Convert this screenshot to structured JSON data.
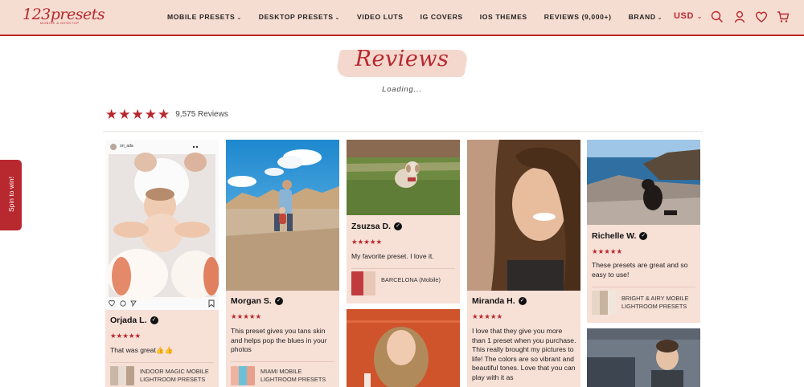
{
  "header": {
    "logo": {
      "text": "123presets",
      "tagline": "MOBILE & DESKTOP"
    },
    "nav": [
      {
        "label": "MOBILE PRESETS",
        "has_dropdown": true
      },
      {
        "label": "DESKTOP PRESETS",
        "has_dropdown": true
      },
      {
        "label": "VIDEO LUTS",
        "has_dropdown": false
      },
      {
        "label": "IG COVERS",
        "has_dropdown": false
      },
      {
        "label": "IOS THEMES",
        "has_dropdown": false
      },
      {
        "label": "REVIEWS (9,000+)",
        "has_dropdown": false
      },
      {
        "label": "BRAND",
        "has_dropdown": true
      }
    ],
    "currency": "USD",
    "icons": [
      "search-icon",
      "account-icon",
      "heart-icon",
      "cart-icon"
    ]
  },
  "page": {
    "title": "Reviews",
    "loading": "Loading..."
  },
  "summary": {
    "rating": 5,
    "count_text": "9,575 Reviews"
  },
  "spin_tab": {
    "label": "Spin to win!"
  },
  "colors": {
    "accent": "#b8282f",
    "header_bg": "#f6ddd1",
    "card_bg": "#f7e0d6"
  },
  "reviews": [
    {
      "name": "Orjada L.",
      "rating": 5,
      "text": "That was great👍👍",
      "product": "INDOOR MAGIC MOBILE LIGHTROOM PRESETS",
      "ig_handle": "ori_ada"
    },
    {
      "name": "Morgan S.",
      "rating": 5,
      "text": "This preset gives you tans skin and helps pop the blues in your photos",
      "product": "MIAMI MOBILE LIGHTROOM PRESETS"
    },
    {
      "name": "Zsuzsa D.",
      "rating": 5,
      "text": "My favorite preset. I love it.",
      "product": "BARCELONA (Mobile)"
    },
    {
      "name": "Miranda H.",
      "rating": 5,
      "text": "I love that they give you more than 1 preset when you purchase. This really brought my pictures to life! The colors are so vibrant and beautiful tones. Love that you can play with it as"
    },
    {
      "name": "Richelle W.",
      "rating": 5,
      "text": "These presets are great and so easy to use!",
      "product": "BRIGHT & AIRY MOBILE LIGHTROOM PRESETS"
    }
  ]
}
